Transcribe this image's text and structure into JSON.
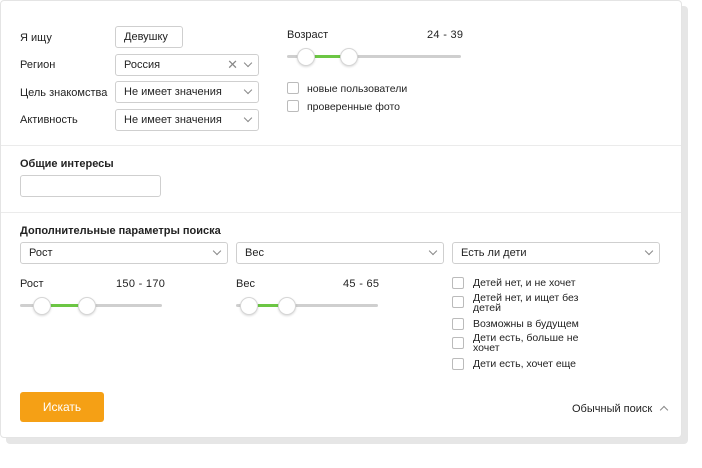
{
  "basic": {
    "seeking_label": "Я ищу",
    "seeking_value": "Девушку",
    "region_label": "Регион",
    "region_value": "Россия",
    "goal_label": "Цель знакомства",
    "goal_value": "Не имеет значения",
    "activity_label": "Активность",
    "activity_value": "Не имеет значения"
  },
  "age": {
    "label": "Возраст",
    "range_text": "24 - 39",
    "min": 24,
    "max": 39
  },
  "flags": {
    "new_users": "новые пользователи",
    "verified_photo": "проверенные фото"
  },
  "interests": {
    "title": "Общие интересы",
    "value": ""
  },
  "extra": {
    "title": "Дополнительные параметры поиска",
    "height_select": "Рост",
    "weight_select": "Вес",
    "kids_select": "Есть ли дети",
    "height_label": "Рост",
    "height_range": "150 - 170",
    "height_min": 150,
    "height_max": 170,
    "weight_label": "Вес",
    "weight_range": "45 - 65",
    "weight_min": 45,
    "weight_max": 65,
    "kids_options": [
      "Детей нет, и не хочет",
      "Детей нет, и ищет без детей",
      "Возможны в будущем",
      "Дети есть, больше не хочет",
      "Дети есть, хочет еще"
    ]
  },
  "actions": {
    "search_button": "Искать",
    "simple_search": "Обычный поиск"
  },
  "colors": {
    "accent": "#f5a015",
    "slider_fill": "#6cc644"
  }
}
